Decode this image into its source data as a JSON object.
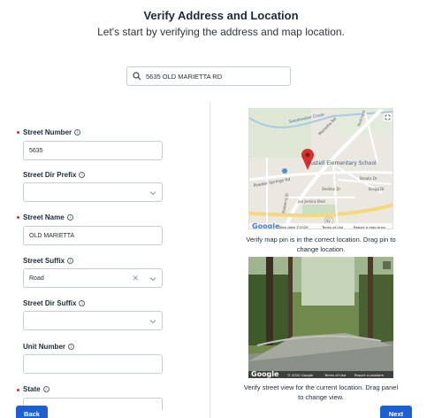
{
  "header": {
    "title": "Verify Address and Location",
    "subtitle": "Let's start by verifying the address and map location."
  },
  "search": {
    "value": "5635 OLD MARIETTA RD",
    "icon": "search-icon"
  },
  "form": {
    "street_number": {
      "label": "Street Number",
      "value": "5635",
      "required": true
    },
    "street_dir_prefix": {
      "label": "Street Dir Prefix",
      "value": ""
    },
    "street_name": {
      "label": "Street Name",
      "value": "OLD MARIETTA",
      "required": true
    },
    "street_suffix": {
      "label": "Street Suffix",
      "value": "Road"
    },
    "street_dir_suffix": {
      "label": "Street Dir Suffix",
      "value": ""
    },
    "unit_number": {
      "label": "Unit Number",
      "value": ""
    },
    "state": {
      "label": "State",
      "required": true
    }
  },
  "map": {
    "labels": {
      "school": "Austell Elementary School",
      "road1": "Powder Springs Rd",
      "road2": "Marietta Rd",
      "road3": "Sweetwater Creek",
      "road4": "Mulberry St",
      "road5": "Joe Jerkins Blvd",
      "road6": "Shelton Dr",
      "road7": "Bragg Dr",
      "road8": "Brooks Dr",
      "road9": "Perkins St",
      "shield": "92"
    },
    "footer": {
      "brand": "Google",
      "data": "Map data ©2020",
      "terms": "Terms of Use",
      "report": "Report a map error"
    },
    "caption": "Verify map pin is in the correct location. Drag pin to change location."
  },
  "street_view": {
    "footer": {
      "brand": "Google",
      "data": "© 2020 Google",
      "terms": "Terms of Use",
      "report": "Report a problem"
    },
    "caption": "Verify street view for the current location. Drag panel to change view."
  },
  "buttons": {
    "back": "Back",
    "next": "Next"
  },
  "colors": {
    "primary": "#1d5fd0",
    "required": "#d0312d",
    "pin": "#d9302c"
  }
}
